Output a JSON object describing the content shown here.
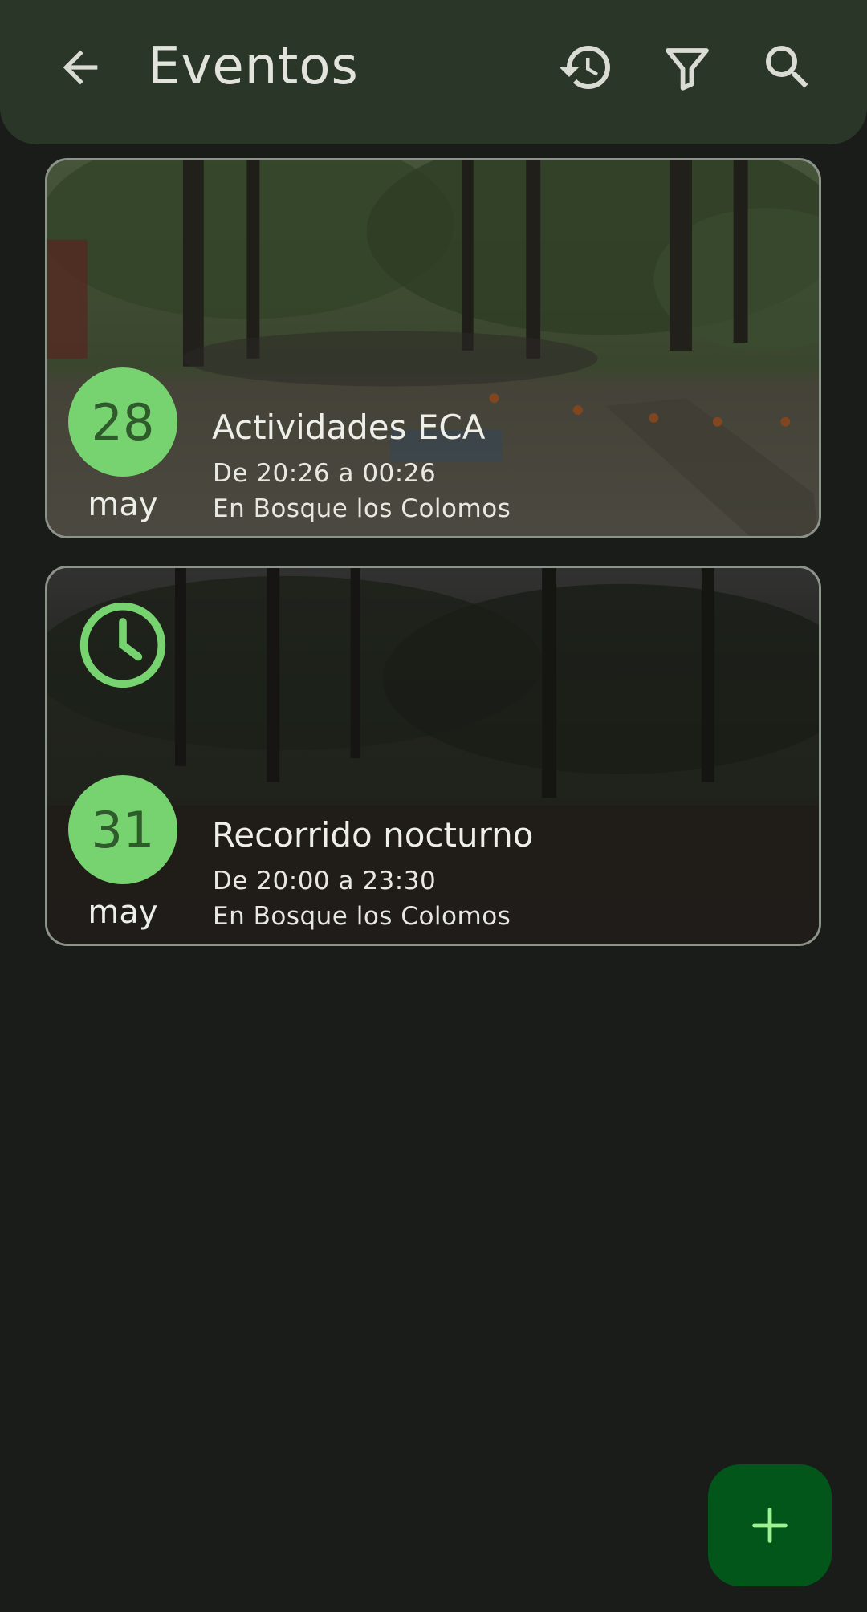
{
  "header": {
    "title": "Eventos",
    "icons": [
      "arrow-back-icon",
      "history-icon",
      "filter-icon",
      "search-icon"
    ]
  },
  "events": [
    {
      "day": "28",
      "month": "may",
      "title": "Actividades ECA",
      "time": "De 20:26 a 00:26",
      "location": "En Bosque los Colomos"
    },
    {
      "day": "31",
      "month": "may",
      "title": "Recorrido nocturno",
      "time": "De 20:00 a 23:30",
      "location": "En Bosque los Colomos",
      "status_icon": "clock-icon"
    }
  ],
  "fab": {
    "icon": "plus-icon"
  },
  "colors": {
    "accent": "#77d36f",
    "appbar": "#2a3728",
    "background": "#1a1c19",
    "fab": "#03561a"
  }
}
